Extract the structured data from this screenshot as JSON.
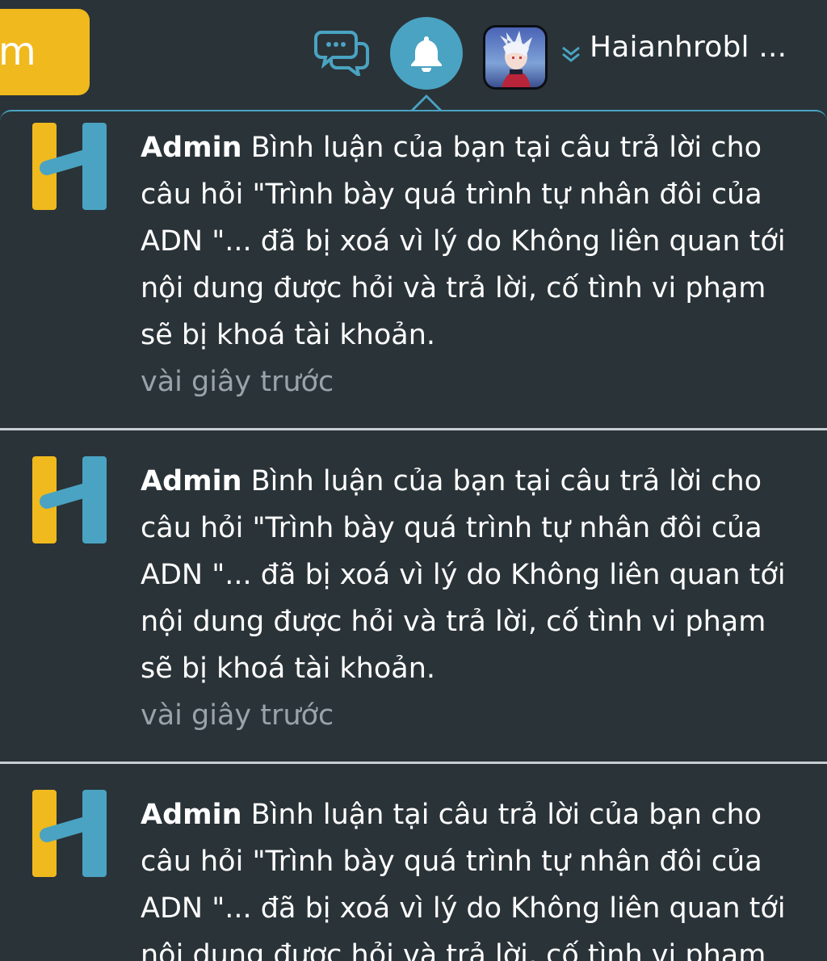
{
  "header": {
    "brand_button_label": "m",
    "username": "Haianhrobl ...",
    "chat_icon": "chat-bubbles-icon",
    "bell_icon": "bell-icon",
    "caret_icon": "chevron-down-icon",
    "colors": {
      "background": "#2a3338",
      "brand_yellow": "#f0b91d",
      "accent_blue": "#4aa3c2",
      "muted_text": "#9aa3a9"
    }
  },
  "notifications": [
    {
      "author": "Admin",
      "message": "Bình luận của bạn tại câu trả lời cho\ncâu hỏi \"Trình bày quá trình tự nhân đôi của\nADN  \"... đã bị xoá vì lý do Không liên quan tới\nnội dung được hỏi và trả lời, cố tình vi phạm\nsẽ bị khoá tài khoản.",
      "time": "vài giây trước"
    },
    {
      "author": "Admin",
      "message": "Bình luận của bạn tại câu trả lời cho\ncâu hỏi \"Trình bày quá trình tự nhân đôi của\nADN  \"... đã bị xoá vì lý do Không liên quan tới\nnội dung được hỏi và trả lời, cố tình vi phạm\nsẽ bị khoá tài khoản.",
      "time": "vài giây trước"
    },
    {
      "author": "Admin",
      "message": "Bình luận tại câu trả lời của bạn cho\ncâu hỏi \"Trình bày quá trình tự nhân đôi của\nADN  \"... đã bị xoá vì lý do Không liên quan tới\nnội dung được hỏi và trả lời, cố tình vi phạm"
    }
  ]
}
